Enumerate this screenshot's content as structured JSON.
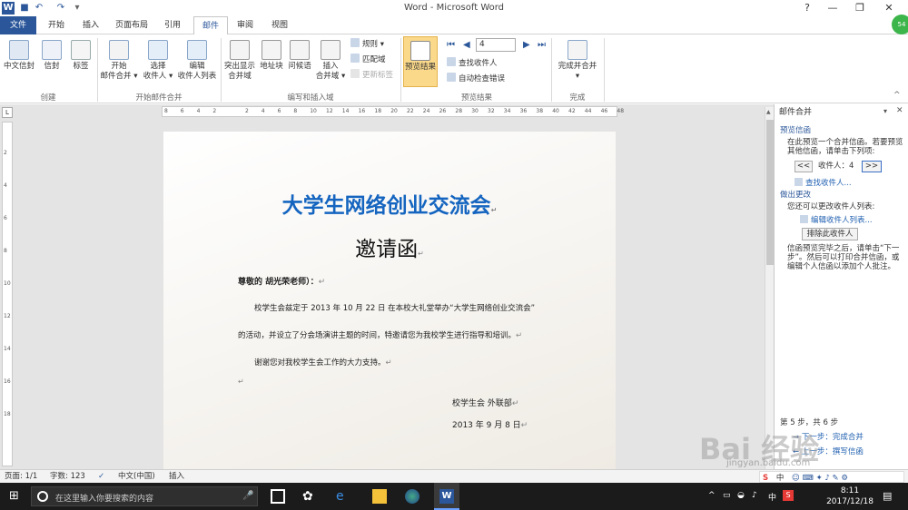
{
  "app": {
    "title": "Word  -  Microsoft Word"
  },
  "tabs": [
    "文件",
    "开始",
    "插入",
    "页面布局",
    "引用",
    "邮件",
    "审阅",
    "视图"
  ],
  "ribbon": {
    "create": {
      "group": "创建",
      "b1": "中文信封",
      "b2": "信封",
      "b3": "标签"
    },
    "start": {
      "group": "开始邮件合并",
      "b1a": "开始",
      "b1b": "邮件合并 ▾",
      "b2a": "选择",
      "b2b": "收件人 ▾",
      "b3a": "编辑",
      "b3b": "收件人列表"
    },
    "write": {
      "group": "编写和插入域",
      "b1a": "突出显示",
      "b1b": "合并域",
      "b2": "地址块",
      "b3": "问候语",
      "b4a": "插入",
      "b4b": "合并域 ▾",
      "s1": "规则 ▾",
      "s2": "匹配域",
      "s3": "更新标签"
    },
    "preview": {
      "group": "预览结果",
      "btn": "预览结果",
      "record": "4",
      "s1": "查找收件人",
      "s2": "自动检查错误"
    },
    "finish": {
      "group": "完成",
      "b1a": "完成并合并",
      "b1b": "▾"
    }
  },
  "ruler": {
    "h": [
      "8",
      "6",
      "4",
      "2",
      "",
      "2",
      "4",
      "6",
      "8",
      "10",
      "12",
      "14",
      "16",
      "18",
      "20",
      "22",
      "24",
      "26",
      "28",
      "30",
      "32",
      "34",
      "36",
      "38",
      "40",
      "42",
      "44",
      "46",
      "48"
    ],
    "v": [
      "2",
      "4",
      "6",
      "8",
      "10",
      "12",
      "14",
      "16",
      "18"
    ]
  },
  "document": {
    "title": "大学生网络创业交流会",
    "subtitle": "邀请函",
    "salutation": "尊敬的   胡光荣老师）：",
    "p1": "校学生会兹定于 2013 年 10 月 22 日 在本校大礼堂举办“大学生网络创业交流会”",
    "p2": "的活动，并设立了分会场演讲主题的时间，特邀请您为我校学生进行指导和培训。",
    "p3": "谢谢您对我校学生会工作的大力支持。",
    "sign1": "校学生会  外联部",
    "sign2": "2013 年 9 月 8 日",
    "mark": "↵"
  },
  "pane": {
    "title": "邮件合并",
    "sec1": "预览信函",
    "t1": "在此预览一个合并信函。若要预览其他信函，请单击下列项:",
    "recipient_label": "收件人：",
    "recipient_no": "4",
    "prev": "<<",
    "next": ">>",
    "find": "查找收件人...",
    "sec2": "做出更改",
    "t2": "您还可以更改收件人列表:",
    "edit": "编辑收件人列表...",
    "exclude": "排除此收件人",
    "t3": "信函预览完毕之后，请单击“下一步”。然后可以打印合并信函，或编辑个人信函以添加个人批注。",
    "step": "第 5 步，共 6 步",
    "next_step": "下一步：完成合并",
    "prev_step": "上一步：撰写信函"
  },
  "status": {
    "page": "页面: 1/1",
    "words": "字数: 123",
    "lang": "中文(中国)",
    "mode": "插入"
  },
  "taskbar": {
    "search": "在这里输入你要搜索的内容",
    "time": "8:11",
    "date": "2017/12/18",
    "ime": "中"
  },
  "watermark": {
    "text": "Bai 经验",
    "url": "jingyan.baidu.com"
  },
  "colors": {
    "accent": "#2b579a",
    "title_blue": "#1565c0",
    "taskbar": "#1b1b1b"
  }
}
